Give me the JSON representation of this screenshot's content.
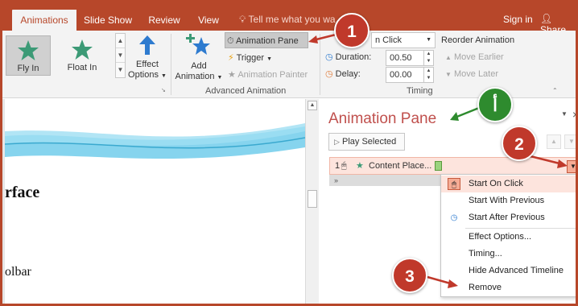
{
  "tabs": {
    "animations": "Animations",
    "slideshow": "Slide Show",
    "review": "Review",
    "view": "View",
    "tellme": "Tell me what you wa",
    "signin": "Sign in",
    "share": "Share"
  },
  "ribbon": {
    "fly_in": "Fly In",
    "float_in": "Float In",
    "effect_options": "Effect",
    "effect_options2": "Options",
    "add_animation": "Add",
    "add_animation2": "Animation",
    "animation_pane": "Animation Pane",
    "trigger": "Trigger",
    "animation_painter": "Animation Painter",
    "start_value": "n Click",
    "duration_label": "Duration:",
    "duration_value": "00.50",
    "delay_label": "Delay:",
    "delay_value": "00.00",
    "reorder": "Reorder Animation",
    "move_earlier": "Move Earlier",
    "move_later": "Move Later",
    "group_advanced": "Advanced Animation",
    "group_timing": "Timing"
  },
  "slide": {
    "text1": "rface",
    "text2": "olbar"
  },
  "pane": {
    "title": "Animation Pane",
    "play_selected": "Play Selected",
    "item_number": "1",
    "item_label": "Content Place..."
  },
  "menu": {
    "start_on_click": "Start On Click",
    "start_with_previous": "Start With Previous",
    "start_after_previous": "Start After Previous",
    "effect_options": "Effect Options...",
    "timing": "Timing...",
    "hide_timeline": "Hide Advanced Timeline",
    "remove": "Remove"
  },
  "callouts": {
    "one": "1",
    "two": "2",
    "three": "3",
    "a": "أ"
  },
  "colors": {
    "accent": "#b7472a",
    "callout_red": "#c0392b",
    "callout_green": "#2e8b2e",
    "pane_title": "#c0504d"
  }
}
